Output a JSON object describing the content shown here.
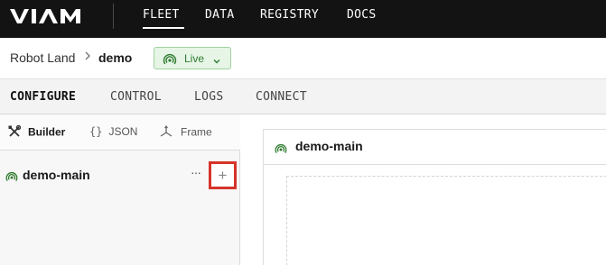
{
  "nav": {
    "logo": "VIAM",
    "items": [
      {
        "label": "FLEET",
        "active": true
      },
      {
        "label": "DATA"
      },
      {
        "label": "REGISTRY"
      },
      {
        "label": "DOCS"
      }
    ]
  },
  "breadcrumb": {
    "org": "Robot Land",
    "separator": "›",
    "robot": "demo",
    "status": {
      "label": "Live",
      "color": "#2f7a2f"
    }
  },
  "tabs": [
    {
      "label": "CONFIGURE",
      "active": true
    },
    {
      "label": "CONTROL"
    },
    {
      "label": "LOGS"
    },
    {
      "label": "CONNECT"
    }
  ],
  "modes": {
    "builder": {
      "label": "Builder",
      "icon": "builder-tools-icon"
    },
    "json": {
      "label": "JSON",
      "icon_text": "{}"
    },
    "frame": {
      "label": "Frame",
      "icon": "frame-axes-icon"
    }
  },
  "tree": {
    "machine_label": "demo-main",
    "more": "···",
    "add": "+"
  },
  "main": {
    "card_title": "demo-main"
  },
  "colors": {
    "topbar": "#131313",
    "live_green": "#2f7a2f",
    "highlight_red": "#d6332a"
  }
}
